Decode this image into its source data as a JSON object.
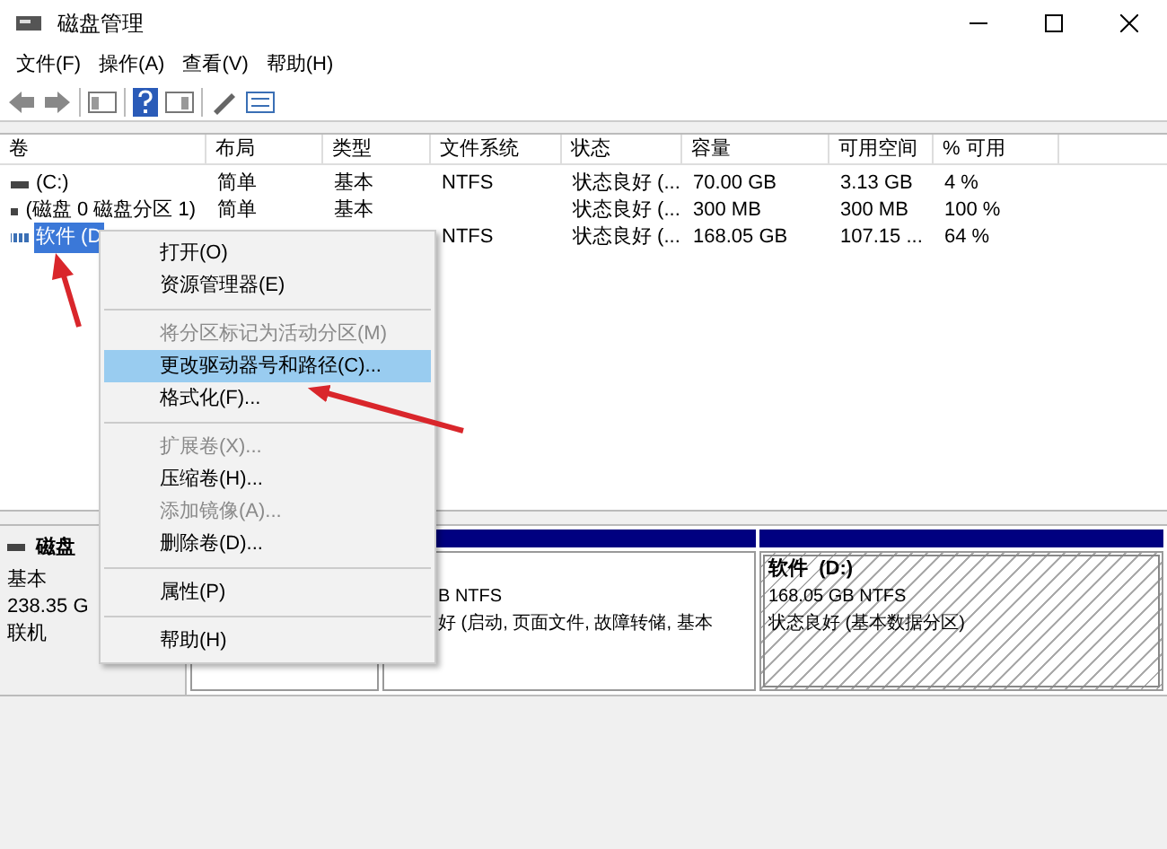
{
  "window": {
    "title": "磁盘管理"
  },
  "menu": [
    {
      "label": "文件(F)"
    },
    {
      "label": "操作(A)"
    },
    {
      "label": "查看(V)"
    },
    {
      "label": "帮助(H)"
    }
  ],
  "table": {
    "columns": [
      "卷",
      "布局",
      "类型",
      "文件系统",
      "状态",
      "容量",
      "可用空间",
      "% 可用"
    ],
    "rows": [
      {
        "selected": false,
        "kind": "plain",
        "volume": "(C:)",
        "layout": "简单",
        "type": "基本",
        "file_system": "NTFS",
        "status": "状态良好 (...",
        "capacity": "70.00 GB",
        "free_space": "3.13 GB",
        "percent_free": "4 %"
      },
      {
        "selected": false,
        "kind": "plain",
        "volume": "(磁盘 0 磁盘分区 1)",
        "layout": "简单",
        "type": "基本",
        "status": "状态良好 (...",
        "capacity": "300 MB",
        "free_space": "300 MB",
        "percent_free": "100 %"
      },
      {
        "selected": true,
        "kind": "striped",
        "volume": "软件 (D",
        "file_system": "NTFS",
        "status": "状态良好 (...",
        "capacity": "168.05 GB",
        "free_space": "107.15 ...",
        "percent_free": "64 %"
      }
    ]
  },
  "context_menu": [
    {
      "kind": "item",
      "label": "打开(O)",
      "disabled": false,
      "selected": false
    },
    {
      "kind": "item",
      "label": "资源管理器(E)",
      "disabled": false,
      "selected": false
    },
    {
      "kind": "separator"
    },
    {
      "kind": "item",
      "label": "将分区标记为活动分区(M)",
      "disabled": true,
      "selected": false
    },
    {
      "kind": "item",
      "label": "更改驱动器号和路径(C)...",
      "disabled": false,
      "selected": true
    },
    {
      "kind": "item",
      "label": "格式化(F)...",
      "disabled": false,
      "selected": false
    },
    {
      "kind": "separator"
    },
    {
      "kind": "item",
      "label": "扩展卷(X)...",
      "disabled": true,
      "selected": false
    },
    {
      "kind": "item",
      "label": "压缩卷(H)...",
      "disabled": false,
      "selected": false
    },
    {
      "kind": "item",
      "label": "添加镜像(A)...",
      "disabled": true,
      "selected": false
    },
    {
      "kind": "item",
      "label": "删除卷(D)...",
      "disabled": false,
      "selected": false
    },
    {
      "kind": "separator"
    },
    {
      "kind": "item",
      "label": "属性(P)",
      "disabled": false,
      "selected": false
    },
    {
      "kind": "separator"
    },
    {
      "kind": "item",
      "label": "帮助(H)",
      "disabled": false,
      "selected": false
    }
  ],
  "disk": {
    "title": "磁盘",
    "lines": [
      "基本",
      "238.35 G",
      "联机"
    ],
    "partitions": [
      {
        "hatched": false
      },
      {
        "kind": "primary",
        "hatched": false,
        "lines": [
          "B NTFS",
          "好 (启动, 页面文件, 故障转储, 基本"
        ]
      },
      {
        "kind": "primary",
        "hatched": true,
        "name": "软件  (D:)",
        "lines": [
          "168.05 GB NTFS",
          "状态良好 (基本数据分区)"
        ]
      }
    ]
  }
}
